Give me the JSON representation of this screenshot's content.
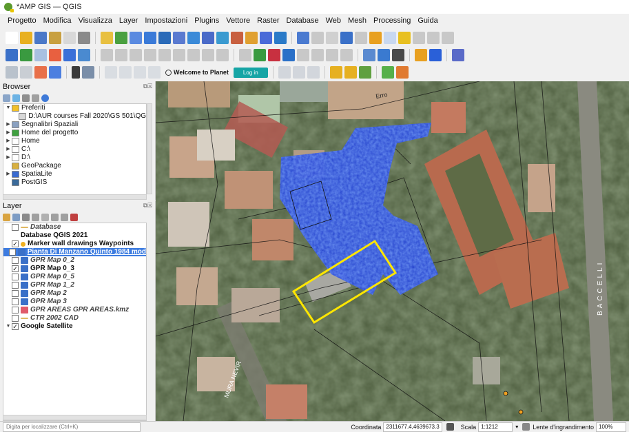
{
  "window": {
    "title": "*AMP GIS — QGIS"
  },
  "menu": [
    "Progetto",
    "Modifica",
    "Visualizza",
    "Layer",
    "Impostazioni",
    "Plugins",
    "Vettore",
    "Raster",
    "Database",
    "Web",
    "Mesh",
    "Processing",
    "Guida"
  ],
  "planet": {
    "welcome": "Welcome to Planet",
    "login": "Log in"
  },
  "browser": {
    "title": "Browser",
    "items": [
      {
        "label": "Preferiti",
        "icon": "star-icon",
        "expanded": true,
        "indent": 0
      },
      {
        "label": "D:\\AUR courses Fall 2020\\GS 501\\QG",
        "icon": "folder-icon",
        "indent": 1
      },
      {
        "label": "Segnalibri Spaziali",
        "icon": "bookmark-icon",
        "indent": 0
      },
      {
        "label": "Home del progetto",
        "icon": "project-home-icon",
        "indent": 0
      },
      {
        "label": "Home",
        "icon": "home-folder-icon",
        "indent": 0
      },
      {
        "label": "C:\\",
        "icon": "drive-icon",
        "indent": 0
      },
      {
        "label": "D:\\",
        "icon": "drive-icon",
        "indent": 0
      },
      {
        "label": "GeoPackage",
        "icon": "geopackage-icon",
        "indent": 0
      },
      {
        "label": "SpatiaLite",
        "icon": "spatialite-icon",
        "indent": 0
      },
      {
        "label": "PostGIS",
        "icon": "postgis-icon",
        "indent": 0
      }
    ]
  },
  "layers": {
    "title": "Layer",
    "items": [
      {
        "label": "Database",
        "checked": false,
        "style": "italic",
        "icon": "line-icon"
      },
      {
        "label": "Database QGIS 2021",
        "checked": false,
        "style": "bold",
        "icon": ""
      },
      {
        "label": "Marker wall drawings Waypoints",
        "checked": true,
        "style": "bold",
        "icon": "point-icon"
      },
      {
        "label": "Pianta Di Manzano Quinto 1984 mod",
        "checked": true,
        "style": "selected",
        "icon": "raster-icon"
      },
      {
        "label": "GPR Map 0_2",
        "checked": false,
        "style": "italic",
        "icon": "raster-icon"
      },
      {
        "label": "GPR Map 0_3",
        "checked": true,
        "style": "bold",
        "icon": "raster-icon"
      },
      {
        "label": "GPR Map 0_5",
        "checked": false,
        "style": "italic",
        "icon": "raster-icon"
      },
      {
        "label": "GPR Map 1_2",
        "checked": false,
        "style": "italic",
        "icon": "raster-icon"
      },
      {
        "label": "GPR Map 2",
        "checked": false,
        "style": "italic",
        "icon": "raster-icon"
      },
      {
        "label": "GPR Map 3",
        "checked": false,
        "style": "italic",
        "icon": "raster-icon"
      },
      {
        "label": "GPR AREAS GPR AREAS.kmz",
        "checked": false,
        "style": "italic",
        "icon": "polygon-icon"
      },
      {
        "label": "CTR 2002 CAD",
        "checked": false,
        "style": "italic",
        "icon": "line-icon"
      },
      {
        "label": "Google Satellite",
        "checked": true,
        "style": "bold-group",
        "icon": ""
      }
    ]
  },
  "map": {
    "street_labels": [
      "BACCELLI",
      "MURA NEVIR"
    ],
    "line_label": "Erro"
  },
  "status": {
    "locator_placeholder": "Digita per localizzare (Ctrl+K)",
    "coord_label": "Coordinata",
    "coord_value": "2311677.4,4639673.3",
    "scale_label": "Scala",
    "scale_value": "1:1212",
    "magnifier_label": "Lente d'ingrandimento",
    "magnifier_value": "100%"
  },
  "colors": {
    "accent": "#3d7ce0",
    "planet_login": "#16a5a5",
    "gpr_overlay": "#1f3fd8",
    "highlight_polygon": "#ffe600"
  }
}
